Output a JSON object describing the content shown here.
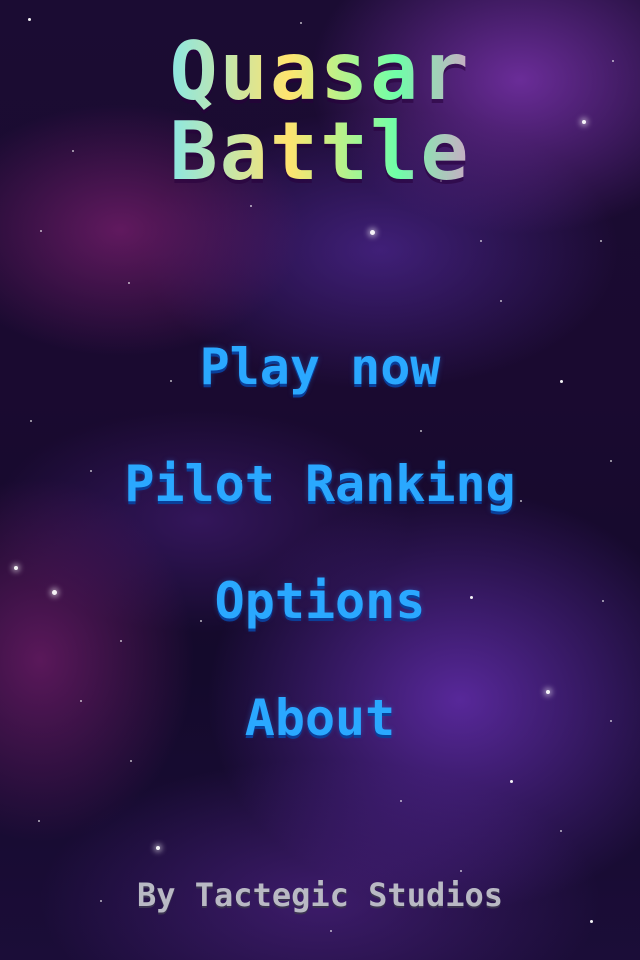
{
  "title": "Quasar Battle",
  "menu": {
    "items": [
      {
        "label": "Play now"
      },
      {
        "label": "Pilot Ranking"
      },
      {
        "label": "Options"
      },
      {
        "label": "About"
      }
    ]
  },
  "footer": {
    "credit": "By Tactegic Studios"
  },
  "colors": {
    "menu_text": "#2aa8ff",
    "credit_text": "#b9b9c4",
    "background": "#1b0c33"
  }
}
